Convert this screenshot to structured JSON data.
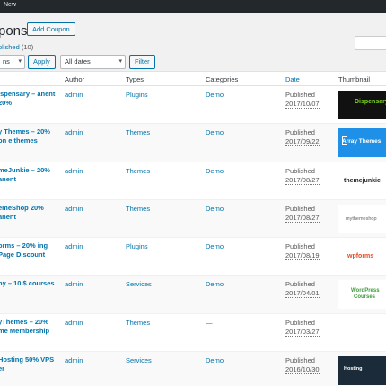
{
  "adminbar": {
    "new_label": "New"
  },
  "page": {
    "title": "pons",
    "add_button": "Add Coupon"
  },
  "filters": {
    "published_link": "blished",
    "published_count": "(10)",
    "bulk_select": "ns",
    "apply_button": "Apply",
    "date_select": "All dates",
    "filter_button": "Filter"
  },
  "table": {
    "columns": [
      "Author",
      "Types",
      "Categories",
      "Date",
      "Thumbnail"
    ],
    "rows": [
      {
        "title": "ispensary – anent 20%",
        "author": "admin",
        "type": "Plugins",
        "category": "Demo",
        "status": "Published",
        "date": "2017/10/07",
        "thumb": "Dispensary"
      },
      {
        "title": "y Themes – 20% on e themes",
        "author": "admin",
        "type": "Themes",
        "category": "Demo",
        "status": "Published",
        "date": "2017/09/22",
        "thumb": "Array Themes"
      },
      {
        "title": "meJunkie – 20% anent",
        "author": "admin",
        "type": "Themes",
        "category": "Demo",
        "status": "Published",
        "date": "2017/08/27",
        "thumb": "themejunkie"
      },
      {
        "title": "emeShop 20% anent",
        "author": "admin",
        "type": "Themes",
        "category": "Demo",
        "status": "Published",
        "date": "2017/08/27",
        "thumb": "mythemeshop"
      },
      {
        "title": "orms – 20% ing Page Discount",
        "author": "admin",
        "type": "Plugins",
        "category": "Demo",
        "status": "Published",
        "date": "2017/08/19",
        "thumb": "wpforms"
      },
      {
        "title": "ny – 10 $ courses",
        "author": "admin",
        "type": "Services",
        "category": "Demo",
        "status": "Published",
        "date": "2017/04/01",
        "thumb": "WordPress Courses"
      },
      {
        "title": "yThemes – 20% me Membership",
        "author": "admin",
        "type": "Themes",
        "category": "—",
        "status": "Published",
        "date": "2017/03/27",
        "thumb": ""
      },
      {
        "title": "Hosting 50% VPS er",
        "author": "admin",
        "type": "Services",
        "category": "Demo",
        "status": "Published",
        "date": "2016/10/30",
        "thumb": "Hosting"
      }
    ]
  }
}
